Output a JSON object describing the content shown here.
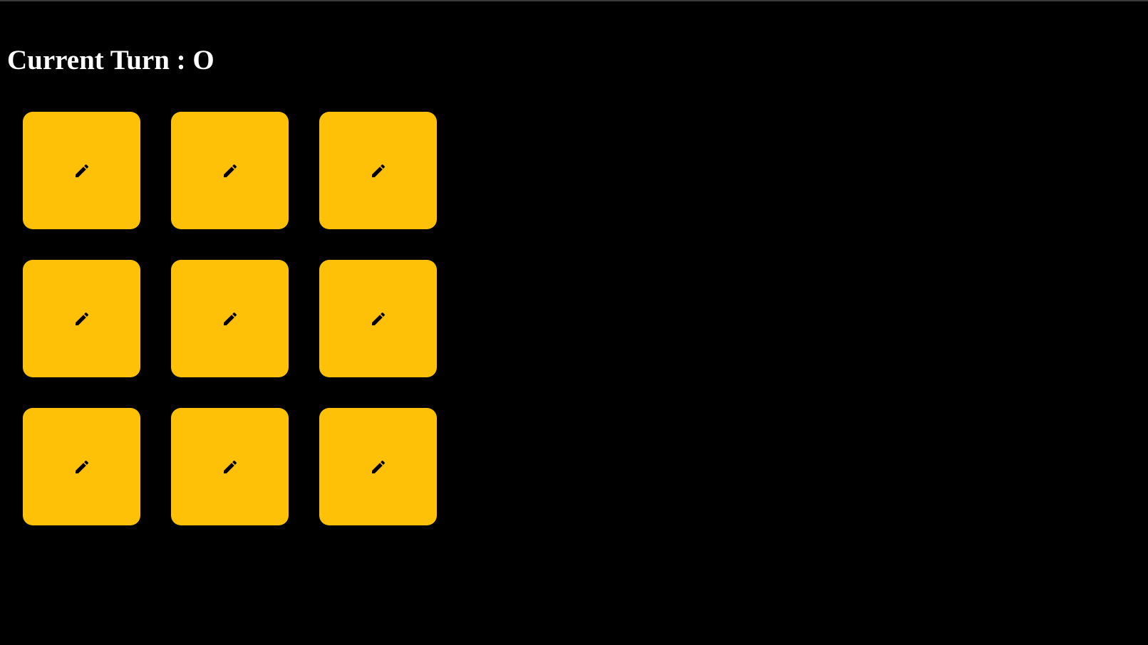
{
  "game": {
    "turn_label": "Current Turn : O",
    "current_turn": "O",
    "board": {
      "rows": 3,
      "cols": 3,
      "cells": [
        {
          "mark": "",
          "icon": "pencil-icon"
        },
        {
          "mark": "",
          "icon": "pencil-icon"
        },
        {
          "mark": "",
          "icon": "pencil-icon"
        },
        {
          "mark": "",
          "icon": "pencil-icon"
        },
        {
          "mark": "",
          "icon": "pencil-icon"
        },
        {
          "mark": "",
          "icon": "pencil-icon"
        },
        {
          "mark": "",
          "icon": "pencil-icon"
        },
        {
          "mark": "",
          "icon": "pencil-icon"
        },
        {
          "mark": "",
          "icon": "pencil-icon"
        }
      ]
    }
  },
  "colors": {
    "background": "#000000",
    "cell": "#ffc107",
    "heading": "#ffffff",
    "icon": "#000000"
  }
}
